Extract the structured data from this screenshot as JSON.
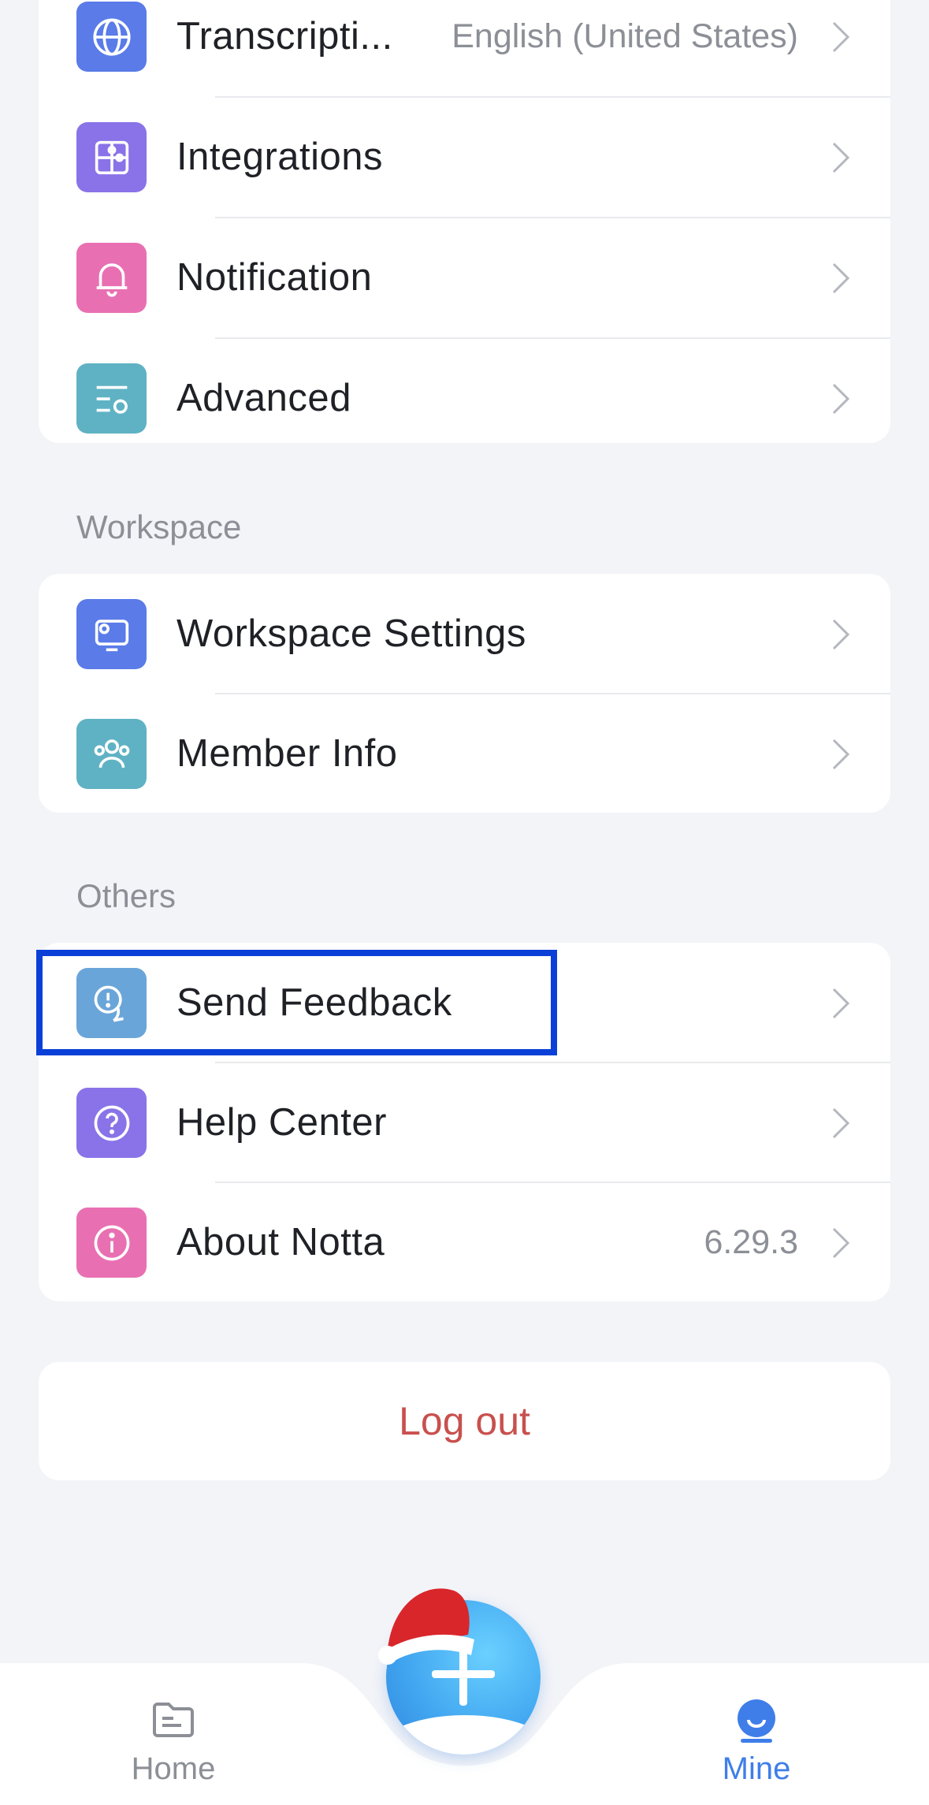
{
  "colors": {
    "background": "#f3f4f8",
    "accent_blue": "#3f7ee8",
    "logout_red": "#c8504e",
    "highlight_border": "#0a40d8"
  },
  "settings_card": {
    "items": [
      {
        "label": "Transcripti...",
        "value": "English (United States)",
        "icon": "globe-icon",
        "color": "#5a7be8"
      },
      {
        "label": "Integrations",
        "value": "",
        "icon": "puzzle-icon",
        "color": "#8a73e8"
      },
      {
        "label": "Notification",
        "value": "",
        "icon": "bell-icon",
        "color": "#e870b2"
      },
      {
        "label": "Advanced",
        "value": "",
        "icon": "advanced-settings-icon",
        "color": "#5fb2c4"
      }
    ]
  },
  "workspace": {
    "title": "Workspace",
    "items": [
      {
        "label": "Workspace Settings",
        "icon": "workspace-settings-icon",
        "color": "#5a7be8"
      },
      {
        "label": "Member Info",
        "icon": "members-icon",
        "color": "#5fb2c4"
      }
    ]
  },
  "others": {
    "title": "Others",
    "items": [
      {
        "label": "Send Feedback",
        "value": "",
        "icon": "feedback-icon",
        "color": "#6aa5d9"
      },
      {
        "label": "Help Center",
        "value": "",
        "icon": "help-icon",
        "color": "#8a73e8"
      },
      {
        "label": "About Notta",
        "value": "6.29.3",
        "icon": "info-icon",
        "color": "#e870b2"
      }
    ]
  },
  "logout": {
    "label": "Log out"
  },
  "tabbar": {
    "home": {
      "label": "Home",
      "icon": "home-folder-icon",
      "color": "#8c8f96"
    },
    "mine": {
      "label": "Mine",
      "icon": "profile-icon",
      "color": "#3f7ee8"
    },
    "add": {
      "icon": "plus-icon"
    }
  }
}
